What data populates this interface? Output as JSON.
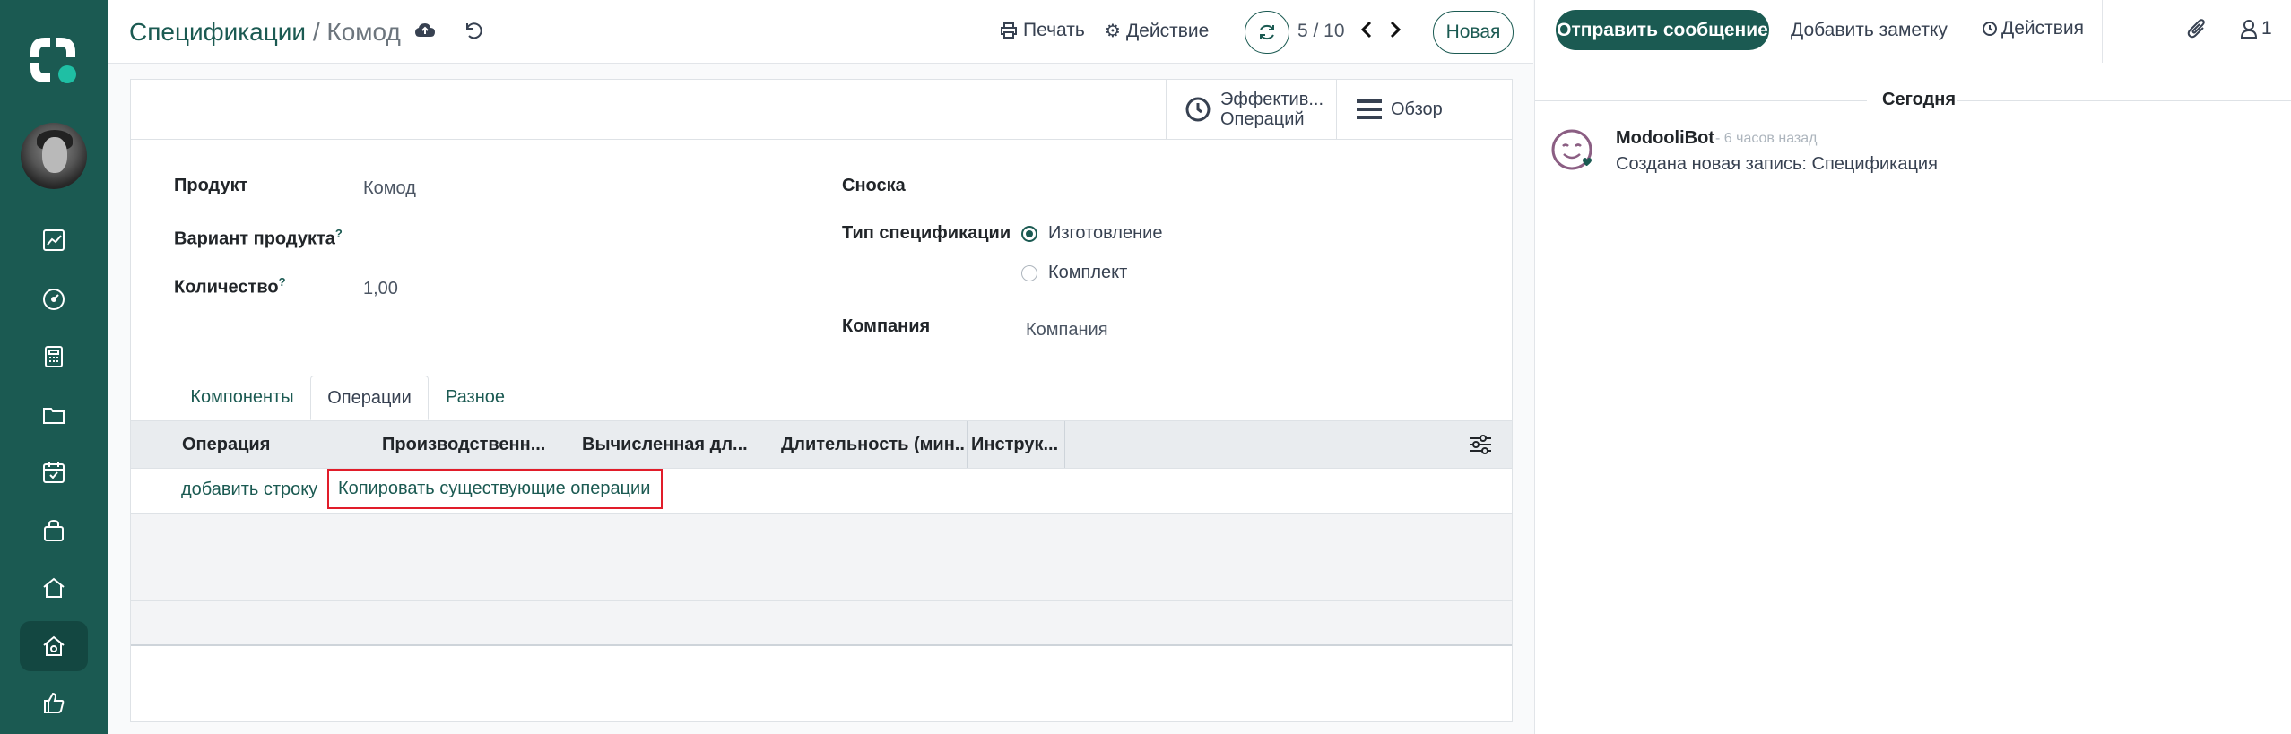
{
  "breadcrumb": {
    "parent": "Спецификации",
    "separator": "/",
    "current": "Комод"
  },
  "toolbar": {
    "print_label": "Печать",
    "action_label": "Действие",
    "new_label": "Новая"
  },
  "pager": {
    "value": "5 / 10"
  },
  "smart_buttons": {
    "efficiency_line1": "Эффектив...",
    "efficiency_line2": "Операций",
    "overview_label": "Обзор"
  },
  "form": {
    "product_label": "Продукт",
    "product_value": "Комод",
    "variant_label": "Вариант продукта",
    "variant_help": "?",
    "quantity_label": "Количество",
    "quantity_help": "?",
    "quantity_value": "1,00",
    "reference_label": "Сноска",
    "bom_type_label": "Тип спецификации",
    "bom_type_options": [
      {
        "label": "Изготовление",
        "selected": true
      },
      {
        "label": "Комплект",
        "selected": false
      }
    ],
    "company_label": "Компания",
    "company_placeholder": "Компания"
  },
  "tabs": [
    {
      "label": "Компоненты"
    },
    {
      "label": "Операции",
      "active": true
    },
    {
      "label": "Разное"
    }
  ],
  "operations_table": {
    "columns": [
      "Операция",
      "Производственн...",
      "Вычисленная дл...",
      "Длительность (мин...",
      "Инструк..."
    ],
    "add_line_label": "добавить строку",
    "copy_label": "Копировать существующие операции"
  },
  "chatter": {
    "send_message_label": "Отправить сообщение",
    "add_note_label": "Добавить заметку",
    "actions_label": "Действия",
    "followers_count": "1",
    "date_separator": "Сегодня",
    "messages": [
      {
        "author": "ModooliBot",
        "time": "- 6 часов назад",
        "body": "Создана новая запись: Спецификация"
      }
    ]
  },
  "colors": {
    "sidebar": "#1b5a52",
    "accent": "#1b5a52",
    "highlight_border": "#e11d2a"
  }
}
